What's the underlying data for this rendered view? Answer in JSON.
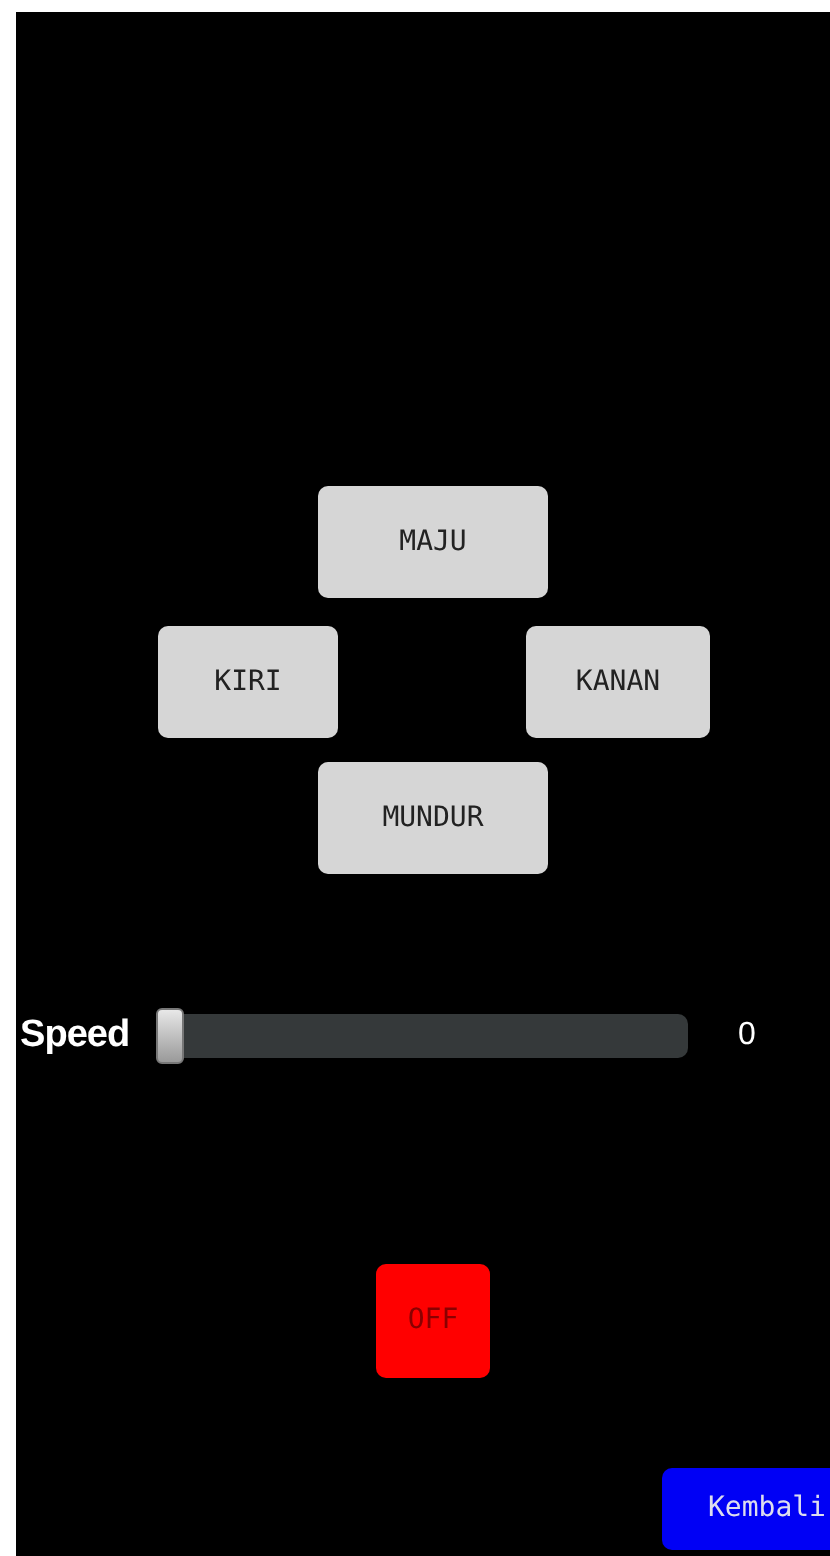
{
  "direction_buttons": [
    {
      "label": "MAJU",
      "kind": "up"
    },
    {
      "label": "KIRI",
      "kind": "left"
    },
    {
      "label": "KANAN",
      "kind": "right"
    },
    {
      "label": "MUNDUR",
      "kind": "down"
    }
  ],
  "speed": {
    "label": "Speed",
    "level": 0,
    "reading": "0"
  },
  "power_button": {
    "label": "OFF",
    "on": false
  },
  "back_button": {
    "label": "Kembali"
  }
}
